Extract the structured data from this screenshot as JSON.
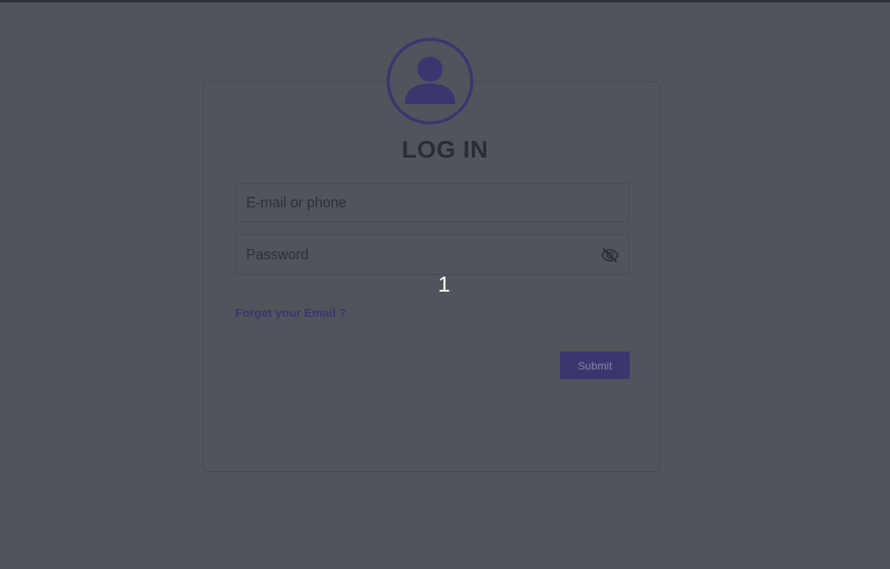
{
  "page": {
    "title": "LOG IN"
  },
  "form": {
    "email_placeholder": "E-mail or phone",
    "email_value": "",
    "password_placeholder": "Password",
    "password_value": "",
    "forgot_link": "Forget your Email ?",
    "submit_label": "Submit"
  },
  "overlay": {
    "marker": "1"
  },
  "icons": {
    "avatar": "user-icon",
    "password_toggle": "eye-off-icon"
  },
  "colors": {
    "background": "#52545c",
    "accent": "#3a3670",
    "title": "#2b2d33",
    "border": "#474951"
  }
}
